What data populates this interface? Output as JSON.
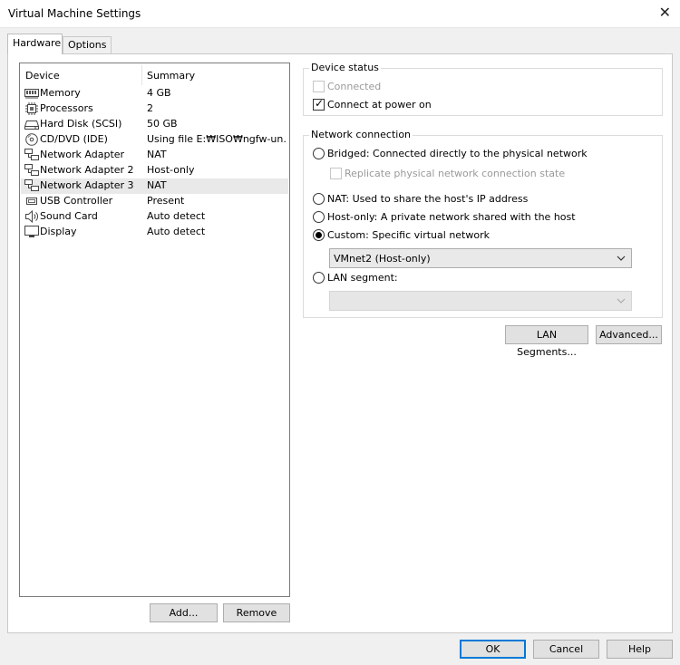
{
  "window": {
    "title": "Virtual Machine Settings",
    "close_glyph": "✕"
  },
  "tabs": [
    {
      "label": "Hardware",
      "active": true
    },
    {
      "label": "Options",
      "active": false
    }
  ],
  "device_list": {
    "header_device": "Device",
    "header_summary": "Summary",
    "rows": [
      {
        "icon": "memory-icon",
        "device": "Memory",
        "summary": "4 GB"
      },
      {
        "icon": "processor-icon",
        "device": "Processors",
        "summary": "2"
      },
      {
        "icon": "hard-disk-icon",
        "device": "Hard Disk (SCSI)",
        "summary": "50 GB"
      },
      {
        "icon": "cd-dvd-icon",
        "device": "CD/DVD (IDE)",
        "summary": "Using file E:₩ISO₩ngfw-un..."
      },
      {
        "icon": "network-adapter-icon",
        "device": "Network Adapter",
        "summary": "NAT"
      },
      {
        "icon": "network-adapter-icon",
        "device": "Network Adapter 2",
        "summary": "Host-only"
      },
      {
        "icon": "network-adapter-icon",
        "device": "Network Adapter 3",
        "summary": "NAT",
        "selected": true
      },
      {
        "icon": "usb-controller-icon",
        "device": "USB Controller",
        "summary": "Present"
      },
      {
        "icon": "sound-card-icon",
        "device": "Sound Card",
        "summary": "Auto detect"
      },
      {
        "icon": "display-icon",
        "device": "Display",
        "summary": "Auto detect"
      }
    ]
  },
  "list_buttons": {
    "add_label": "Add...",
    "remove_label": "Remove"
  },
  "device_status": {
    "legend": "Device status",
    "connected_label": "Connected",
    "connected_checked": false,
    "connect_at_power_on_label": "Connect at power on",
    "connect_at_power_on_checked": true
  },
  "network_connection": {
    "legend": "Network connection",
    "bridged_label": "Bridged: Connected directly to the physical network",
    "replicate_label": "Replicate physical network connection state",
    "nat_label": "NAT: Used to share the host's IP address",
    "host_only_label": "Host-only: A private network shared with the host",
    "custom_label": "Custom: Specific virtual network",
    "custom_selected": true,
    "custom_network_value": "VMnet2 (Host-only)",
    "lan_segment_label": "LAN segment:",
    "lan_segment_value": ""
  },
  "network_buttons": {
    "lan_segments_label": "LAN Segments...",
    "advanced_label": "Advanced..."
  },
  "dialog_buttons": {
    "ok_label": "OK",
    "cancel_label": "Cancel",
    "help_label": "Help"
  }
}
